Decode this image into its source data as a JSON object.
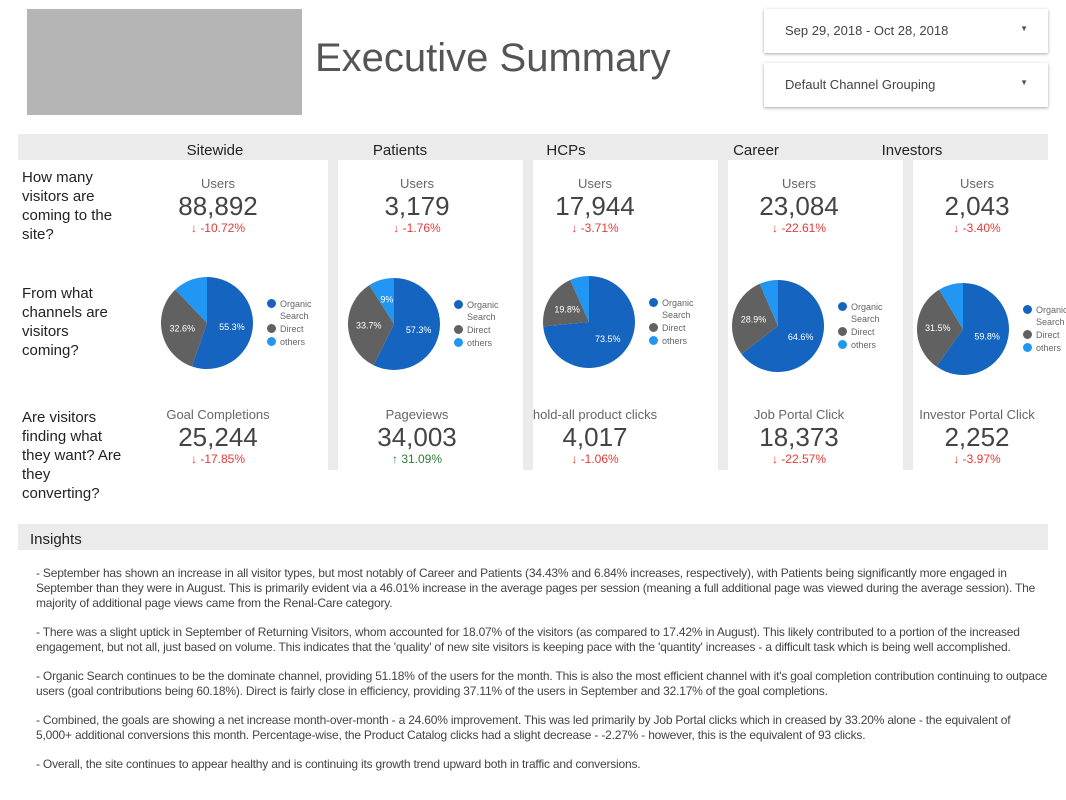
{
  "header": {
    "title": "Executive Summary",
    "date_range": "Sep 29, 2018 - Oct 28, 2018",
    "dimension": "Default Channel Grouping"
  },
  "columns": [
    "Sitewide",
    "Patients",
    "HCPs",
    "Career",
    "Investors"
  ],
  "questions": [
    "How many visitors are coming to the site?",
    "From what channels are visitors coming?",
    "Are visitors finding what they want?  Are they converting?"
  ],
  "colors": {
    "organic": "#1565c0",
    "direct": "#616161",
    "others": "#2196f3",
    "negative": "#e53935",
    "positive": "#2e7d32"
  },
  "legend": [
    "Organic Search",
    "Direct",
    "others"
  ],
  "cards": [
    {
      "users_label": "Users",
      "users": "88,892",
      "users_change": "-10.72%",
      "pie": [
        55.3,
        32.6,
        12.1
      ],
      "pie_labels": [
        "55.3%",
        "32.6%",
        ""
      ],
      "goal_label": "Goal Completions",
      "goal": "25,244",
      "goal_change": "-17.85%",
      "goal_dir": "down"
    },
    {
      "users_label": "Users",
      "users": "3,179",
      "users_change": "-1.76%",
      "pie": [
        57.3,
        33.7,
        9.0
      ],
      "pie_labels": [
        "57.3%",
        "33.7%",
        "9%"
      ],
      "goal_label": "Pageviews",
      "goal": "34,003",
      "goal_change": "31.09%",
      "goal_dir": "up"
    },
    {
      "users_label": "Users",
      "users": "17,944",
      "users_change": "-3.71%",
      "pie": [
        73.5,
        19.8,
        6.7
      ],
      "pie_labels": [
        "73.5%",
        "19.8%",
        ""
      ],
      "goal_label": "hold-all product clicks",
      "goal": "4,017",
      "goal_change": "-1.06%",
      "goal_dir": "down"
    },
    {
      "users_label": "Users",
      "users": "23,084",
      "users_change": "-22.61%",
      "pie": [
        64.6,
        28.9,
        6.5
      ],
      "pie_labels": [
        "64.6%",
        "28.9%",
        ""
      ],
      "goal_label": "Job Portal Click",
      "goal": "18,373",
      "goal_change": "-22.57%",
      "goal_dir": "down"
    },
    {
      "users_label": "Users",
      "users": "2,043",
      "users_change": "-3.40%",
      "pie": [
        59.8,
        31.5,
        8.7
      ],
      "pie_labels": [
        "59.8%",
        "31.5%",
        ""
      ],
      "goal_label": "Investor Portal Click",
      "goal": "2,252",
      "goal_change": "-3.97%",
      "goal_dir": "down"
    }
  ],
  "insights": {
    "title": "Insights",
    "paragraphs": [
      "- September has shown an increase in all visitor types, but most notably of Career and Patients (34.43% and 6.84% increases, respectively), with Patients being significantly more engaged in September than they were in August. This is primarily evident via a 46.01% increase in the average pages per session (meaning a full additional page was viewed during the average session). The majority of additional page views came from the Renal-Care category.",
      "- There was a slight uptick in September of Returning Visitors, whom accounted for 18.07% of the visitors (as compared to 17.42% in August). This likely contributed to a portion of the increased engagement, but not all, just based on volume. This indicates that the 'quality' of new site visitors is keeping pace with the 'quantity' increases - a difficult task which is being well accomplished.",
      "- Organic Search continues to be the dominate channel, providing 51.18% of the users for the month. This is also the most efficient channel with it's goal completion contribution continuing to outpace users (goal contributions being 60.18%). Direct is fairly close in efficiency, providing 37.11% of the users in September and 32.17% of the goal completions.",
      "- Combined, the goals are showing a net increase month-over-month - a 24.60% improvement. This was led primarily by Job Portal clicks which in creased by 33.20% alone - the equivalent of 5,000+ additional conversions this month. Percentage-wise, the Product Catalog clicks had a slight decrease - -2.27% - however, this is the equivalent of 93 clicks.",
      "- Overall, the site continues to appear healthy and is continuing its growth trend upward both in traffic and conversions."
    ]
  }
}
